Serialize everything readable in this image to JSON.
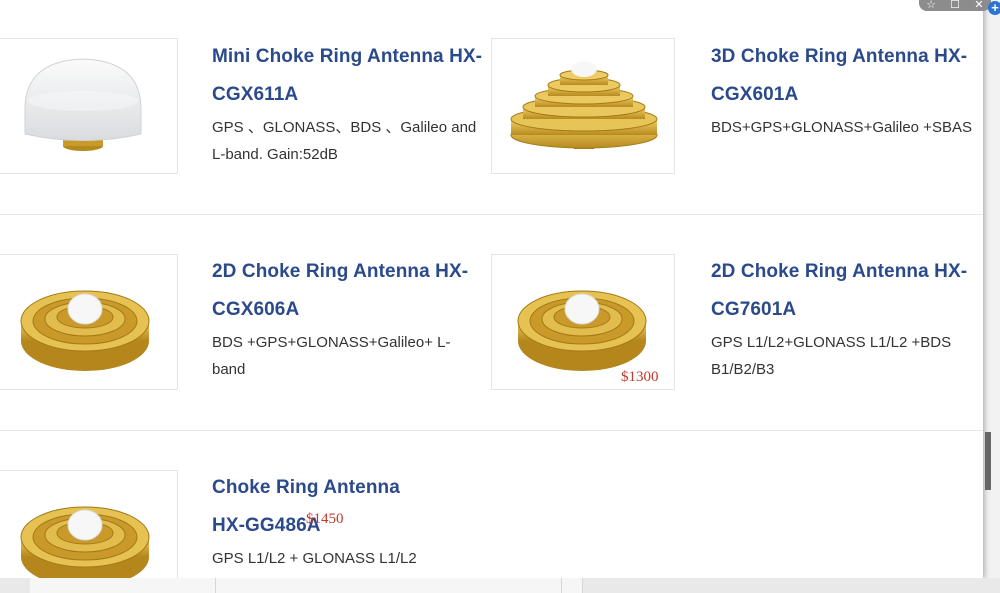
{
  "products": [
    {
      "title": "Mini Choke Ring Antenna HX-CGX611A",
      "desc": "GPS 、GLONASS、BDS 、Galileo and L-band. Gain:52dB",
      "price": "",
      "image": "white-dome-antenna"
    },
    {
      "title": "3D Choke Ring Antenna HX-CGX601A",
      "desc": "BDS+GPS+GLONASS+Galileo +SBAS",
      "price": "",
      "image": "gold-stacked-choke-ring"
    },
    {
      "title": "2D Choke Ring Antenna HX-CGX606A",
      "desc": "BDS +GPS+GLONASS+Galileo+ L-band",
      "price": "",
      "image": "gold-choke-ring"
    },
    {
      "title": "2D Choke Ring Antenna HX-CG7601A",
      "desc": "GPS L1/L2+GLONASS L1/L2 +BDS B1/B2/B3",
      "price": "$1300",
      "image": "gold-choke-ring"
    },
    {
      "title": "Choke Ring Antenna HX-GG486A",
      "desc": "GPS L1/L2 + GLONASS L1/L2",
      "price": "$1450",
      "image": "gold-choke-ring"
    }
  ],
  "toolbar": {
    "pin_icon": "pin-icon",
    "restore_icon": "restore-icon",
    "close_icon": "close-icon",
    "add_icon": "plus-circle-icon"
  },
  "colors": {
    "title": "#2b4a8b",
    "price": "#c0392b",
    "gold": "#d4a628"
  }
}
